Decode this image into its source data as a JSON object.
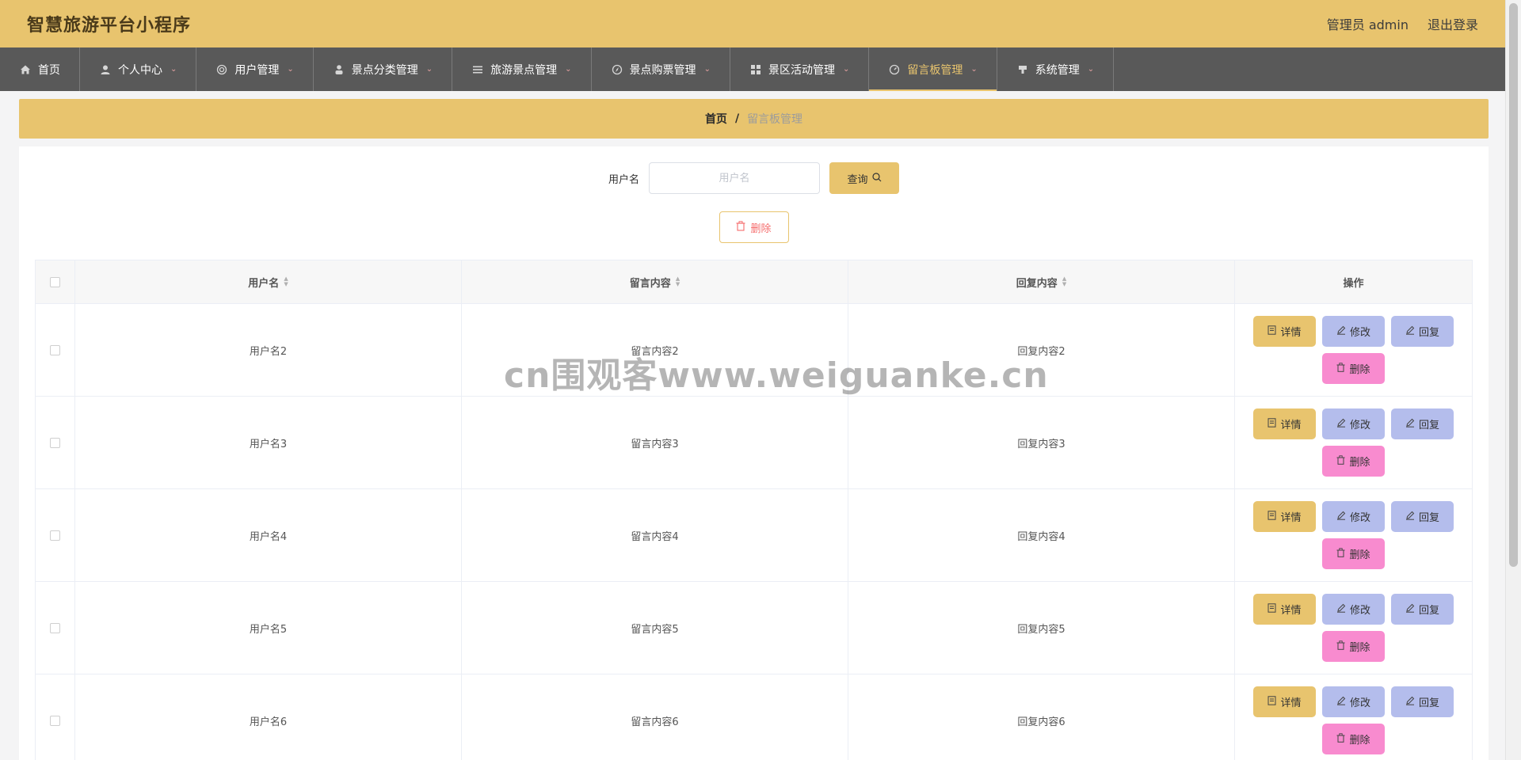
{
  "header": {
    "title": "智慧旅游平台小程序",
    "user": "管理员 admin",
    "logout": "退出登录"
  },
  "nav": [
    {
      "label": "首页",
      "icon": "home-icon",
      "has_menu": false
    },
    {
      "label": "个人中心",
      "icon": "user-icon",
      "has_menu": true
    },
    {
      "label": "用户管理",
      "icon": "users-icon",
      "has_menu": true
    },
    {
      "label": "景点分类管理",
      "icon": "person-icon",
      "has_menu": true
    },
    {
      "label": "旅游景点管理",
      "icon": "list-icon",
      "has_menu": true
    },
    {
      "label": "景点购票管理",
      "icon": "compass-icon",
      "has_menu": true
    },
    {
      "label": "景区活动管理",
      "icon": "grid-icon",
      "has_menu": true
    },
    {
      "label": "留言板管理",
      "icon": "dashboard-icon",
      "has_menu": true,
      "active": true
    },
    {
      "label": "系统管理",
      "icon": "settings-icon",
      "has_menu": true
    }
  ],
  "breadcrumb": {
    "home": "首页",
    "separator": "/",
    "current": "留言板管理"
  },
  "search": {
    "label": "用户名",
    "placeholder": "用户名",
    "value": "",
    "button": "查询"
  },
  "toolbar": {
    "delete_label": "删除"
  },
  "table": {
    "columns": [
      "用户名",
      "留言内容",
      "回复内容",
      "操作"
    ],
    "actions": {
      "detail": "详情",
      "edit": "修改",
      "reply": "回复",
      "remove": "删除"
    },
    "rows": [
      {
        "username": "用户名2",
        "content": "留言内容2",
        "reply": "回复内容2"
      },
      {
        "username": "用户名3",
        "content": "留言内容3",
        "reply": "回复内容3"
      },
      {
        "username": "用户名4",
        "content": "留言内容4",
        "reply": "回复内容4"
      },
      {
        "username": "用户名5",
        "content": "留言内容5",
        "reply": "回复内容5"
      },
      {
        "username": "用户名6",
        "content": "留言内容6",
        "reply": "回复内容6"
      }
    ]
  },
  "watermark": "cn围观客www.weiguanke.cn",
  "colors": {
    "accent": "#e8c46e",
    "nav_bg": "#595959",
    "edit": "#b4bdec",
    "remove": "#f88bcf",
    "danger_text": "#f56c6c"
  }
}
